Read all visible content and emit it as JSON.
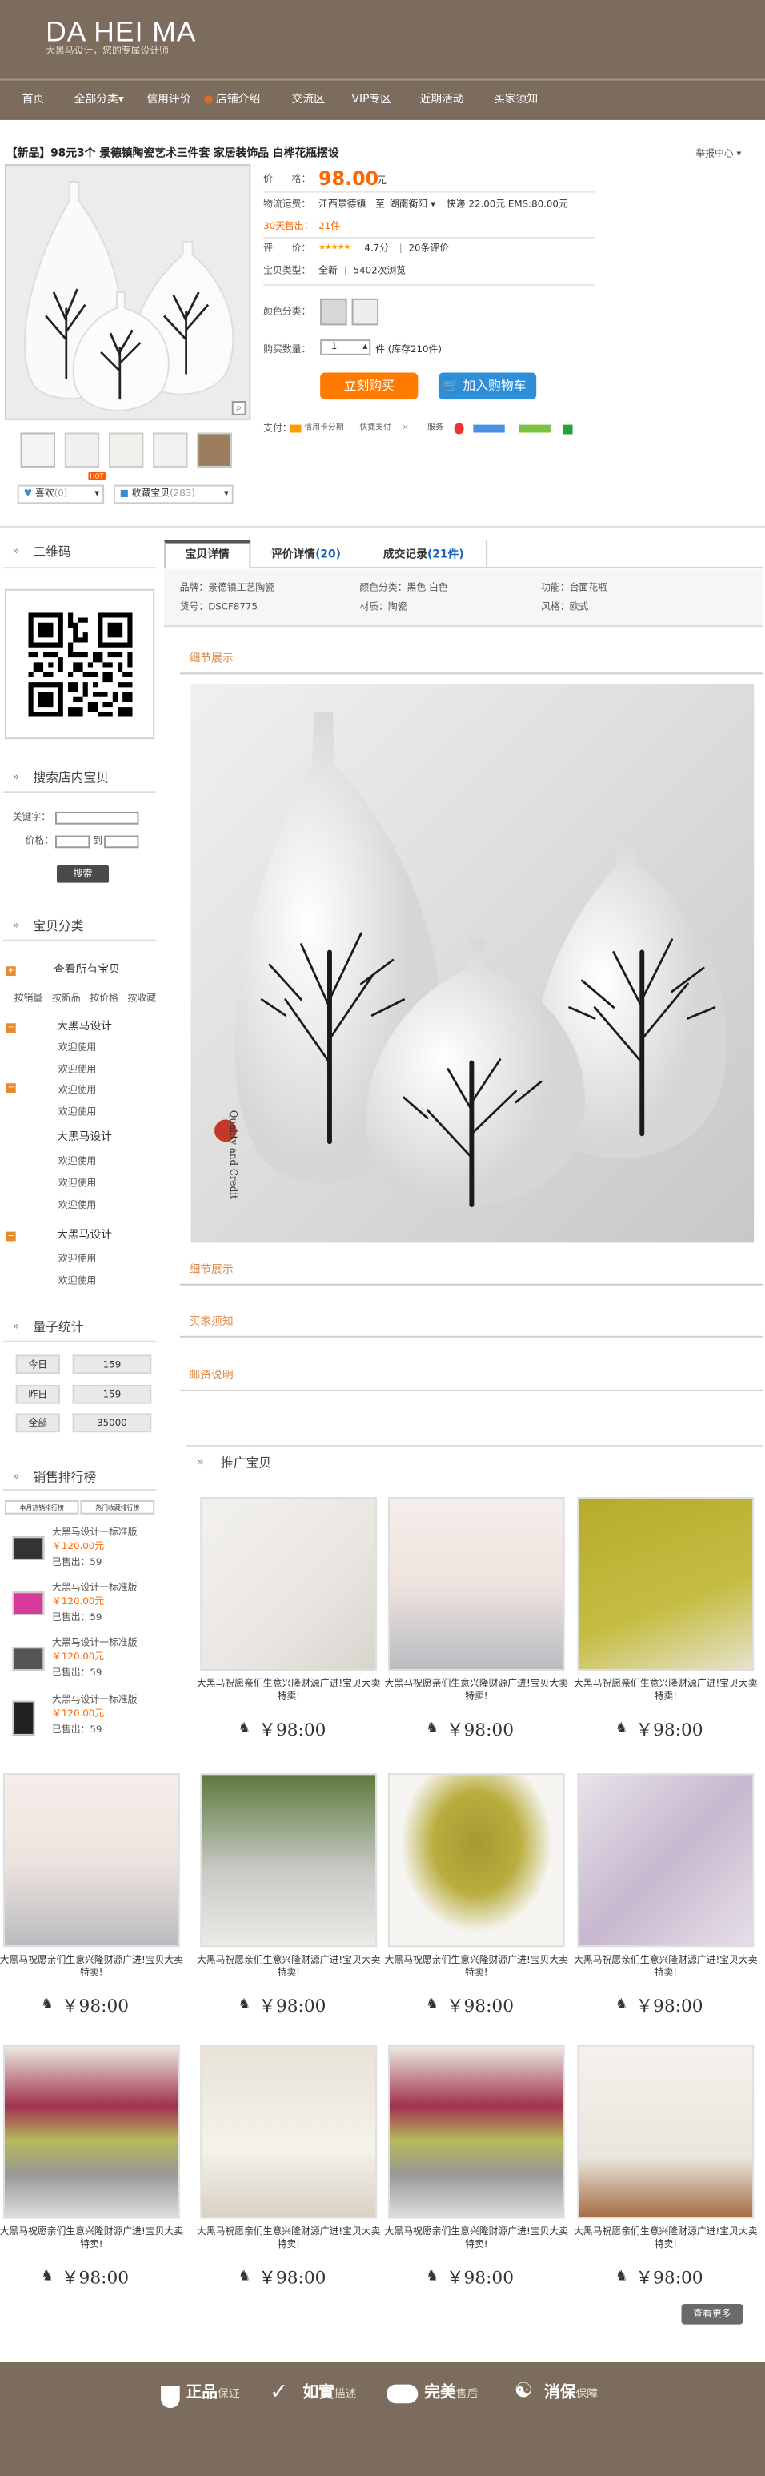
{
  "header": {
    "logo": "DA HEI MA",
    "tagline": "大黑马设计，您的专属设计师",
    "nav": [
      "首页",
      "全部分类▾",
      "信用评价",
      "店铺介绍",
      "交流区",
      "VIP专区",
      "近期活动",
      "买家须知"
    ]
  },
  "product": {
    "title": "【新品】98元3个 景德镇陶瓷艺术三件套 家居装饰品 白桦花瓶摆设",
    "favorite_link": "举报中心",
    "price_label": "价　　格：",
    "price": "98.00",
    "price_unit": "元",
    "ship_label": "物流运费：",
    "ship_from": "江西景德镇",
    "ship_to_sep": "至",
    "ship_to": "湖南衡阳",
    "ship_fees": "快递:22.00元 EMS:80.00元",
    "sold_label": "30天售出：",
    "sold_value": "21件",
    "rating_label": "评　　价：",
    "stars": "★★★★★",
    "rating_value": "4.7分",
    "rating_sep": "|",
    "rating_count": "20条评价",
    "type_label": "宝贝类型：",
    "type_value": "全新",
    "views_sep": "|",
    "views": "5402次浏览",
    "color_label": "颜色分类：",
    "qty_label": "购买数量：",
    "qty_value": "1",
    "qty_stock": "件 (库存210件)",
    "buy_now": "立刻购买",
    "add_cart": "加入购物车",
    "pay_label": "支付：",
    "pay_items": [
      "信用卡分期",
      "快捷支付"
    ],
    "service_label": "服务",
    "like_label": "喜欢",
    "like_count": "(0)",
    "hot_badge": "HOT",
    "collect_label": "收藏宝贝",
    "collect_count": "(283)"
  },
  "sidebar": {
    "qr_title": "二维码",
    "search_title": "搜索店内宝贝",
    "kw_label": "关键字：",
    "price_label": "价格：",
    "to_label": "到",
    "search_btn": "搜索",
    "cat_title": "宝贝分类",
    "all_items": "查看所有宝贝",
    "sort_links": [
      "按销量",
      "按新品",
      "按价格",
      "按收藏"
    ],
    "cat_groups": [
      {
        "name": "大黑马设计",
        "items": [
          "欢迎使用",
          "欢迎使用",
          "欢迎使用",
          "欢迎使用"
        ]
      },
      {
        "name": "大黑马设计",
        "items": [
          "欢迎使用",
          "欢迎使用",
          "欢迎使用"
        ]
      },
      {
        "name": "大黑马设计",
        "items": [
          "欢迎使用",
          "欢迎使用"
        ]
      }
    ],
    "stat_title": "量子统计",
    "stats": [
      {
        "label": "今日",
        "value": "159"
      },
      {
        "label": "昨日",
        "value": "159"
      },
      {
        "label": "全部",
        "value": "35000"
      }
    ],
    "rank_title": "销售排行榜",
    "rank_tabs": [
      "本月热销排行榜",
      "热门收藏排行榜"
    ],
    "rank_items": [
      {
        "name": "大黑马设计一标准版",
        "price": "120.00元",
        "sold": "已售出：59"
      },
      {
        "name": "大黑马设计一标准版",
        "price": "120.00元",
        "sold": "已售出：59"
      },
      {
        "name": "大黑马设计一标准版",
        "price": "120.00元",
        "sold": "已售出：59"
      },
      {
        "name": "大黑马设计一标准版",
        "price": "120.00元",
        "sold": "已售出：59"
      }
    ]
  },
  "detail": {
    "tabs": [
      {
        "label": "宝贝详情"
      },
      {
        "label": "评价详情",
        "count": "(20)"
      },
      {
        "label": "成交记录",
        "count": "(21件)"
      }
    ],
    "attrs": [
      "品牌：景德镇工艺陶瓷",
      "颜色分类：黑色 白色",
      "功能：台面花瓶",
      "货号：DSCF8775",
      "材质：陶瓷",
      "风格：欧式"
    ],
    "sections": [
      "细节展示",
      "细节展示",
      "买家须知",
      "邮资说明"
    ],
    "stamp": "Quality and Credit",
    "promo_title": "推广宝贝",
    "promo_desc": "大黑马祝愿亲们生意兴隆财源广进!宝贝大卖特卖!",
    "promo_price": "￥98:00",
    "products": [
      {
        "price": "￥98:00",
        "img": "card-note"
      },
      {
        "price": "￥98:00",
        "img": "pencil-cups"
      },
      {
        "price": "￥98:00",
        "img": "green-towel"
      },
      {
        "price": "￥98:00",
        "img": "pencil-cups"
      },
      {
        "price": "￥98:00",
        "img": "cutlery-basket"
      },
      {
        "price": "￥98:00",
        "img": "yellow-pillow"
      },
      {
        "price": "￥98:00",
        "img": "washi-tapes"
      },
      {
        "price": "￥98:00",
        "img": "cushion-stack"
      },
      {
        "price": "￥98:00",
        "img": "white-bed"
      },
      {
        "price": "￥98:00",
        "img": "cushion-stack"
      },
      {
        "price": "￥98:00",
        "img": "flower-vase"
      },
      {
        "price": "￥98:00",
        "img": "card-note"
      }
    ],
    "more_btn": "查看更多"
  },
  "footer": [
    {
      "big": "正品",
      "small": "保证"
    },
    {
      "big": "如實",
      "small": "描述"
    },
    {
      "big": "完美",
      "small": "售后"
    },
    {
      "big": "消保",
      "small": "保障"
    }
  ],
  "colors": {
    "brand": "#7b6c5e",
    "price": "#ff6600",
    "buy": "#ff7b00",
    "cart": "#2e8ed8"
  }
}
